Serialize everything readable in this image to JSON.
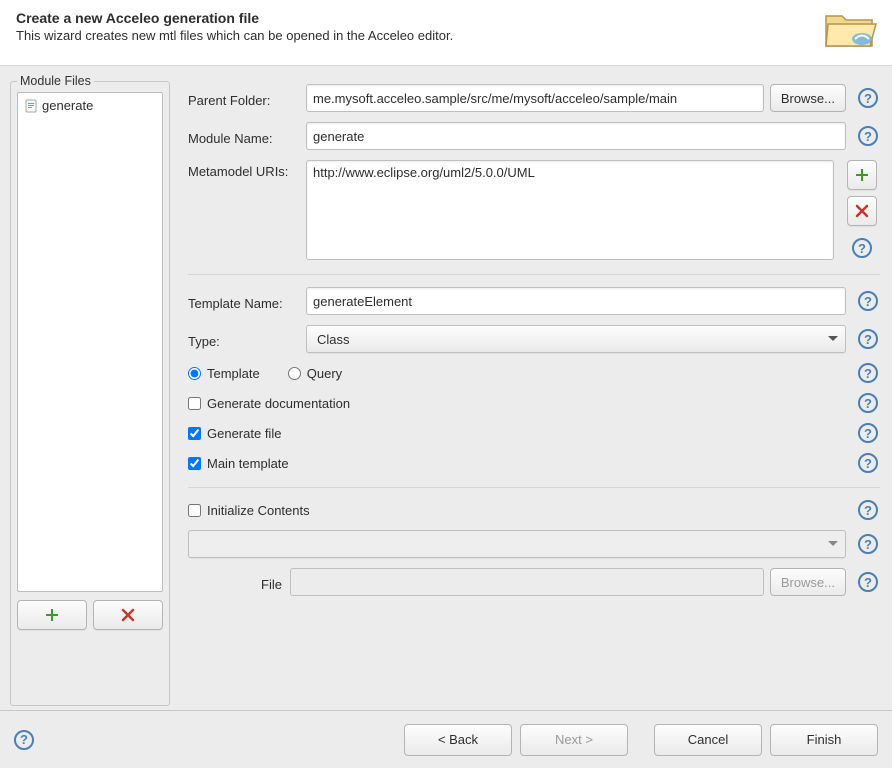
{
  "header": {
    "title": "Create a new Acceleo generation file",
    "subtitle": "This wizard creates new mtl files which can be opened in the Acceleo editor."
  },
  "sidebar": {
    "legend": "Module Files",
    "items": [
      {
        "label": "generate"
      }
    ]
  },
  "form": {
    "parent_folder_label": "Parent Folder:",
    "parent_folder_value": "me.mysoft.acceleo.sample/src/me/mysoft/acceleo/sample/main",
    "browse_label": "Browse...",
    "module_name_label": "Module Name:",
    "module_name_value": "generate",
    "metamodel_uris_label": "Metamodel URIs:",
    "metamodel_uris_items": [
      "http://www.eclipse.org/uml2/5.0.0/UML"
    ],
    "template_name_label": "Template Name:",
    "template_name_value": "generateElement",
    "type_label": "Type:",
    "type_value": "Class",
    "radio_template_label": "Template",
    "radio_query_label": "Query",
    "radio_selected": "template",
    "check_generate_documentation_label": "Generate documentation",
    "check_generate_documentation": false,
    "check_generate_file_label": "Generate file",
    "check_generate_file": true,
    "check_main_template_label": "Main template",
    "check_main_template": true,
    "check_initialize_label": "Initialize Contents",
    "check_initialize": false,
    "init_combo_value": "",
    "file_label": "File",
    "file_value": "",
    "file_browse_label": "Browse..."
  },
  "footer": {
    "back_label": "< Back",
    "next_label": "Next >",
    "cancel_label": "Cancel",
    "finish_label": "Finish"
  }
}
